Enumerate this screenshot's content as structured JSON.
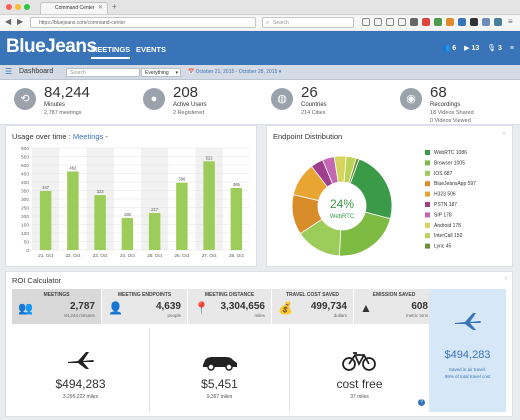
{
  "browser": {
    "tab_title": "Command Center",
    "url": "https://bluejeans.com/command-center",
    "search_placeholder": "Search"
  },
  "app": {
    "logo": "BlueJeans",
    "nav": [
      "MEETINGS",
      "EVENTS"
    ],
    "header_counts": {
      "people": "6",
      "video": "13",
      "audio": "3"
    }
  },
  "subbar": {
    "title": "Dashboard",
    "search_placeholder": "Search",
    "filter_value": "Everything",
    "date_range": "October 21, 2015 - October 28, 2015"
  },
  "stats": [
    {
      "icon": "history-icon",
      "value": "84,244",
      "label": "Minutes",
      "sub": "2,787 meetings"
    },
    {
      "icon": "user-icon",
      "value": "208",
      "label": "Active Users",
      "sub": "2 Registered"
    },
    {
      "icon": "globe-icon",
      "value": "26",
      "label": "Countries",
      "sub": "214 Cities"
    },
    {
      "icon": "camera-icon",
      "value": "68",
      "label": "Recordings",
      "sub": "18 Videos Shared",
      "sub2": "0 Videos Viewed"
    }
  ],
  "usage_panel": {
    "title_prefix": "Usage over time : ",
    "title_link": "Meetings",
    "title_suffix": " -"
  },
  "chart_data": {
    "type": "bar",
    "categories": [
      "21. Oct",
      "22. Oct",
      "23. Oct",
      "24. Oct",
      "25. Oct",
      "26. Oct",
      "27. Oct",
      "28. Oct"
    ],
    "values": [
      347,
      462,
      323,
      188,
      217,
      396,
      522,
      365
    ],
    "ylim": [
      0,
      600
    ],
    "yticks": [
      0,
      50,
      100,
      150,
      200,
      250,
      300,
      350,
      400,
      450,
      500,
      550,
      600
    ],
    "bar_color": "#9ccc5a",
    "grid": true
  },
  "endpoint_panel": {
    "title": "Endpoint Distribution",
    "center_value": "24%",
    "center_label": "WebRTC",
    "legend": [
      {
        "label": "WebRTC 1086",
        "color": "#3b9a48"
      },
      {
        "label": "Browser 1005",
        "color": "#7dbb42"
      },
      {
        "label": "IOS 687",
        "color": "#9ccc5a"
      },
      {
        "label": "BlueJeansApp 597",
        "color": "#d88c2a"
      },
      {
        "label": "H323 506",
        "color": "#e8a532"
      },
      {
        "label": "PSTN 187",
        "color": "#a13f8f"
      },
      {
        "label": "SIP 178",
        "color": "#c568b3"
      },
      {
        "label": "Android 178",
        "color": "#d6d45a"
      },
      {
        "label": "InterCall 150",
        "color": "#bcd35a"
      },
      {
        "label": "Lync 45",
        "color": "#6f8f3a"
      }
    ],
    "values": [
      1086,
      1005,
      687,
      597,
      506,
      187,
      178,
      178,
      150,
      45
    ]
  },
  "roi": {
    "title": "ROI Calculator",
    "strip": [
      {
        "header": "MEETINGS",
        "value": "2,787",
        "unit": "84,244 minutes",
        "icon": "people-icon"
      },
      {
        "header": "MEETING ENDPOINTS",
        "value": "4,639",
        "unit": "people",
        "icon": "endpoint-people-icon"
      },
      {
        "header": "MEETING DISTANCE",
        "value": "3,304,656",
        "unit": "miles",
        "icon": "route-icon"
      },
      {
        "header": "TRAVEL COST SAVED",
        "value": "499,734",
        "unit": "dollars",
        "icon": "money-bag-icon"
      },
      {
        "header": "EMISSION SAVED",
        "value": "608",
        "unit": "metric tons",
        "icon": "emission-icon"
      }
    ],
    "cards": [
      {
        "icon": "plane-icon",
        "value": "$494,283",
        "sub": "3,295,222 miles"
      },
      {
        "icon": "car-icon",
        "value": "$5,451",
        "sub": "9,397 miles"
      },
      {
        "icon": "bicycle-icon",
        "value": "cost free",
        "sub": "37 miles"
      }
    ],
    "saved": {
      "value": "$494,283",
      "line1": "Saved in air travel.",
      "line2": "99% of total travel cost"
    }
  }
}
